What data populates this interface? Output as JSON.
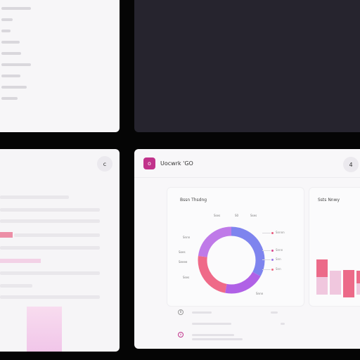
{
  "top_left_menu": {
    "items": [
      "",
      "",
      "",
      "",
      "",
      "",
      "",
      "",
      ""
    ]
  },
  "bottom_left_panel": {
    "action_label": "c"
  },
  "dashboard": {
    "logo_label": "o",
    "app_title": "Uocwrk 'GO",
    "header_action_label": "4",
    "donut_card": {
      "title": "Bssn Thsdng",
      "top_labels": [
        "Sses",
        "S0",
        "Sses"
      ],
      "left_labels": [
        "Snnn",
        "Soes",
        "Seeee",
        "Sses"
      ],
      "bottom_label": "Snnn",
      "legend": [
        {
          "label": "Snnnn",
          "color": "#e75a7c"
        },
        {
          "label": "Snnn",
          "color": "#d9468d"
        },
        {
          "label": "Snn",
          "color": "#9a78e8"
        },
        {
          "label": "Snn",
          "color": "#f06b82"
        }
      ],
      "chart_data": {
        "type": "pie",
        "values": [
          33,
          20,
          24,
          23
        ],
        "colors": [
          "#7e84ee",
          "#b061e6",
          "#ef6a88",
          "#bf7ae8"
        ]
      }
    },
    "bar_card": {
      "title": "Ssts Nnwy",
      "chart_data": {
        "type": "bar",
        "series": [
          {
            "values": [
              62,
              42,
              44,
              42
            ],
            "color": "#f0c7de"
          },
          {
            "values": [
              44,
              0,
              70,
              32
            ],
            "color": "#ec6a89"
          }
        ]
      }
    },
    "rows": [
      {
        "icon": "0"
      },
      {
        "icon": ""
      },
      {
        "icon": "o"
      }
    ]
  }
}
